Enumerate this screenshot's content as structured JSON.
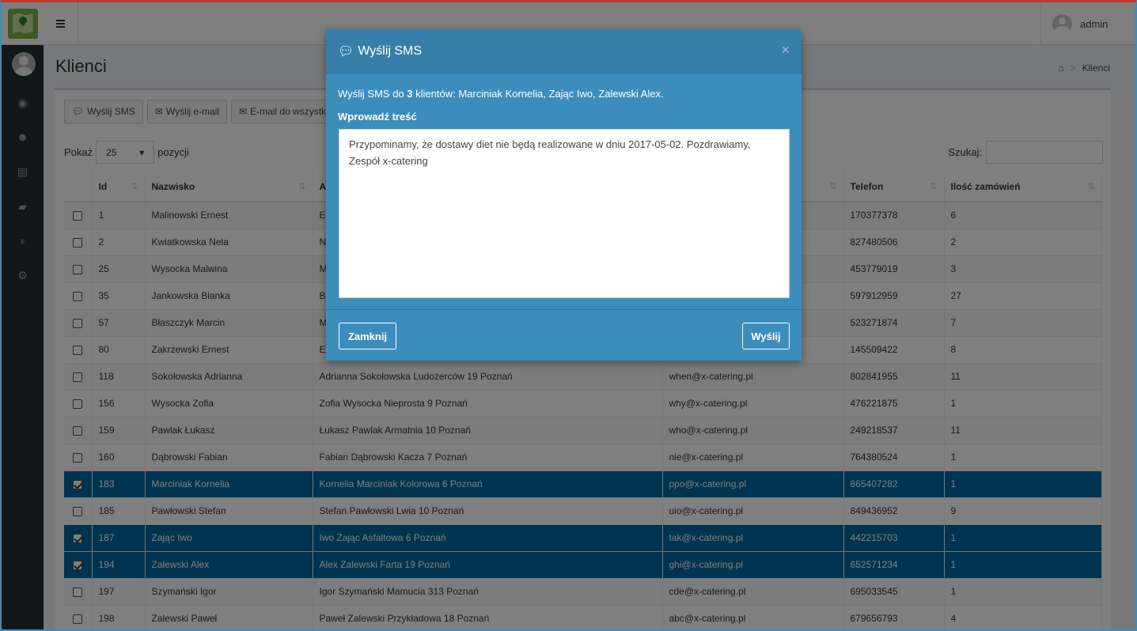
{
  "topbar": {
    "username": "admin"
  },
  "page": {
    "title": "Klienci",
    "breadcrumb_current": "Klienci"
  },
  "toolbar": {
    "sms_label": "Wyślij SMS",
    "email_label": "Wyślij e-mail",
    "email_all_label": "E-mail do wszystkich"
  },
  "length": {
    "prefix": "Pokaż",
    "value": "25",
    "suffix": "pozycji"
  },
  "search": {
    "label": "Szukaj:",
    "value": ""
  },
  "table": {
    "headers": [
      "Id",
      "Nazwisko",
      "A",
      "",
      "Telefon",
      "Ilość zamówień"
    ],
    "rows": [
      {
        "id": "1",
        "name": "Malinowski Ernest",
        "address": "Er",
        "email": "",
        "phone": "170377378",
        "orders": "6",
        "checked": false
      },
      {
        "id": "2",
        "name": "Kwiatkowska Nela",
        "address": "N",
        "email": "",
        "phone": "827480506",
        "orders": "2",
        "checked": false
      },
      {
        "id": "25",
        "name": "Wysocka Malwina",
        "address": "M",
        "email": "",
        "phone": "453779019",
        "orders": "3",
        "checked": false
      },
      {
        "id": "35",
        "name": "Jankowska Blanka",
        "address": "B",
        "email": "",
        "phone": "597912959",
        "orders": "27",
        "checked": false
      },
      {
        "id": "57",
        "name": "Błaszczyk Marcin",
        "address": "M",
        "email": "",
        "phone": "523271874",
        "orders": "7",
        "checked": false
      },
      {
        "id": "80",
        "name": "Zakrzewski Ernest",
        "address": "Er",
        "email": "",
        "phone": "145509422",
        "orders": "8",
        "checked": false
      },
      {
        "id": "118",
        "name": "Sokołowska Adrianna",
        "address": "Adrianna Sokołowska Ludożerców 19 Poznań",
        "email": "when@x-catering.pl",
        "phone": "802841955",
        "orders": "11",
        "checked": false
      },
      {
        "id": "156",
        "name": "Wysocka Zofia",
        "address": "Zofia Wysocka Nieprosta 9 Poznań",
        "email": "why@x-catering.pl",
        "phone": "476221875",
        "orders": "1",
        "checked": false
      },
      {
        "id": "159",
        "name": "Pawlak Łukasz",
        "address": "Łukasz Pawlak Armatnia 10 Poznań",
        "email": "who@x-catering.pl",
        "phone": "249218537",
        "orders": "11",
        "checked": false
      },
      {
        "id": "160",
        "name": "Dąbrowski Fabian",
        "address": "Fabian Dąbrowski Kacza 7 Poznań",
        "email": "nie@x-catering.pl",
        "phone": "764380524",
        "orders": "1",
        "checked": false
      },
      {
        "id": "183",
        "name": "Marciniak Kornelia",
        "address": "Kornelia Marciniak Kolorowa 6 Poznań",
        "email": "ppo@x-catering.pl",
        "phone": "865407282",
        "orders": "1",
        "checked": true
      },
      {
        "id": "185",
        "name": "Pawłowski Stefan",
        "address": "Stefan Pawłowski Lwia 10 Poznań",
        "email": "uio@x-catering.pl",
        "phone": "849436952",
        "orders": "9",
        "checked": false
      },
      {
        "id": "187",
        "name": "Zając Iwo",
        "address": "Iwo Zając Asfaltowa 6 Poznań",
        "email": "tak@x-catering.pl",
        "phone": "442215703",
        "orders": "1",
        "checked": true
      },
      {
        "id": "194",
        "name": "Zalewski Alex",
        "address": "Alex Zalewski Farta 19 Poznań",
        "email": "ghi@x-catering.pl",
        "phone": "652571234",
        "orders": "1",
        "checked": true
      },
      {
        "id": "197",
        "name": "Szymański Igor",
        "address": "Igor Szymański Mamucia 313 Poznań",
        "email": "cde@x-catering.pl",
        "phone": "695033545",
        "orders": "1",
        "checked": false
      },
      {
        "id": "198",
        "name": "Zalewski Paweł",
        "address": "Paweł Zalewski Przykładowa 18 Poznań",
        "email": "abc@x-catering.pl",
        "phone": "679656793",
        "orders": "4",
        "checked": false
      }
    ]
  },
  "modal": {
    "title": "Wyślij SMS",
    "info_prefix": "Wyślij SMS do ",
    "info_count": "3",
    "info_suffix": " klientów: Marciniak Kornelia, Zając Iwo, Zalewski Alex.",
    "content_label": "Wprowadź treść",
    "message": "Przypominamy, że dostawy diet nie będą realizowane w dniu 2017-05-02. Pozdrawiamy, Zespół x-catering",
    "close_label": "Zamknij",
    "send_label": "Wyślij"
  },
  "colors": {
    "accent": "#3c8dbc",
    "selected_row": "#00669e",
    "sidebar": "#222d32"
  }
}
